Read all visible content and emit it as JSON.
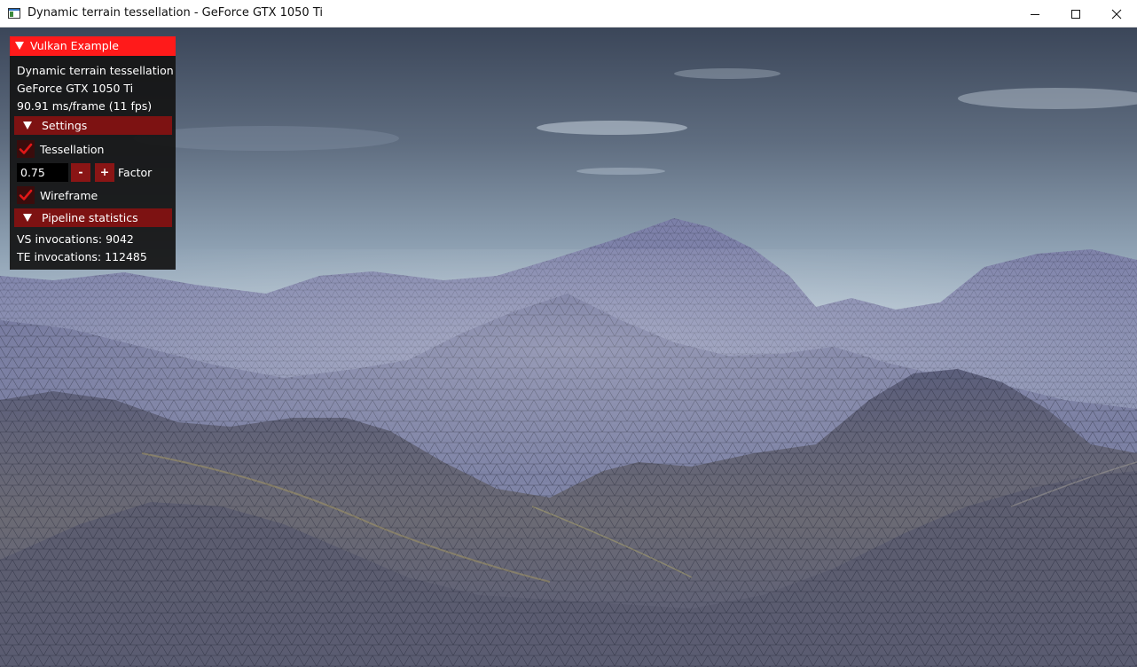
{
  "window": {
    "title": "Dynamic terrain tessellation - GeForce GTX 1050 Ti"
  },
  "overlay": {
    "header": "Vulkan Example",
    "app_name": "Dynamic terrain tessellation",
    "gpu": "GeForce GTX 1050 Ti",
    "frame_time": "90.91 ms/frame (11 fps)",
    "settings": {
      "label": "Settings",
      "tessellation_label": "Tessellation",
      "tessellation_checked": true,
      "factor_value": "0.75",
      "decrement_label": "-",
      "increment_label": "+",
      "factor_label": "Factor",
      "wireframe_label": "Wireframe",
      "wireframe_checked": true
    },
    "pipeline_statistics": {
      "label": "Pipeline statistics",
      "vs_invocations": "VS invocations: 9042",
      "te_invocations": "TE invocations: 112485"
    }
  },
  "colors": {
    "header_red": "#ff1a1a",
    "section_red": "#7d1212",
    "checkmark_red": "#e01818",
    "sky_top": "#3f4a5e",
    "sky_horizon": "#b9c7d4"
  },
  "icons": {
    "app": "vulkan-app-icon",
    "minimize": "minimize-icon",
    "maximize": "maximize-icon",
    "close": "close-icon",
    "collapse": "triangle-down-icon",
    "check": "checkmark-icon"
  }
}
